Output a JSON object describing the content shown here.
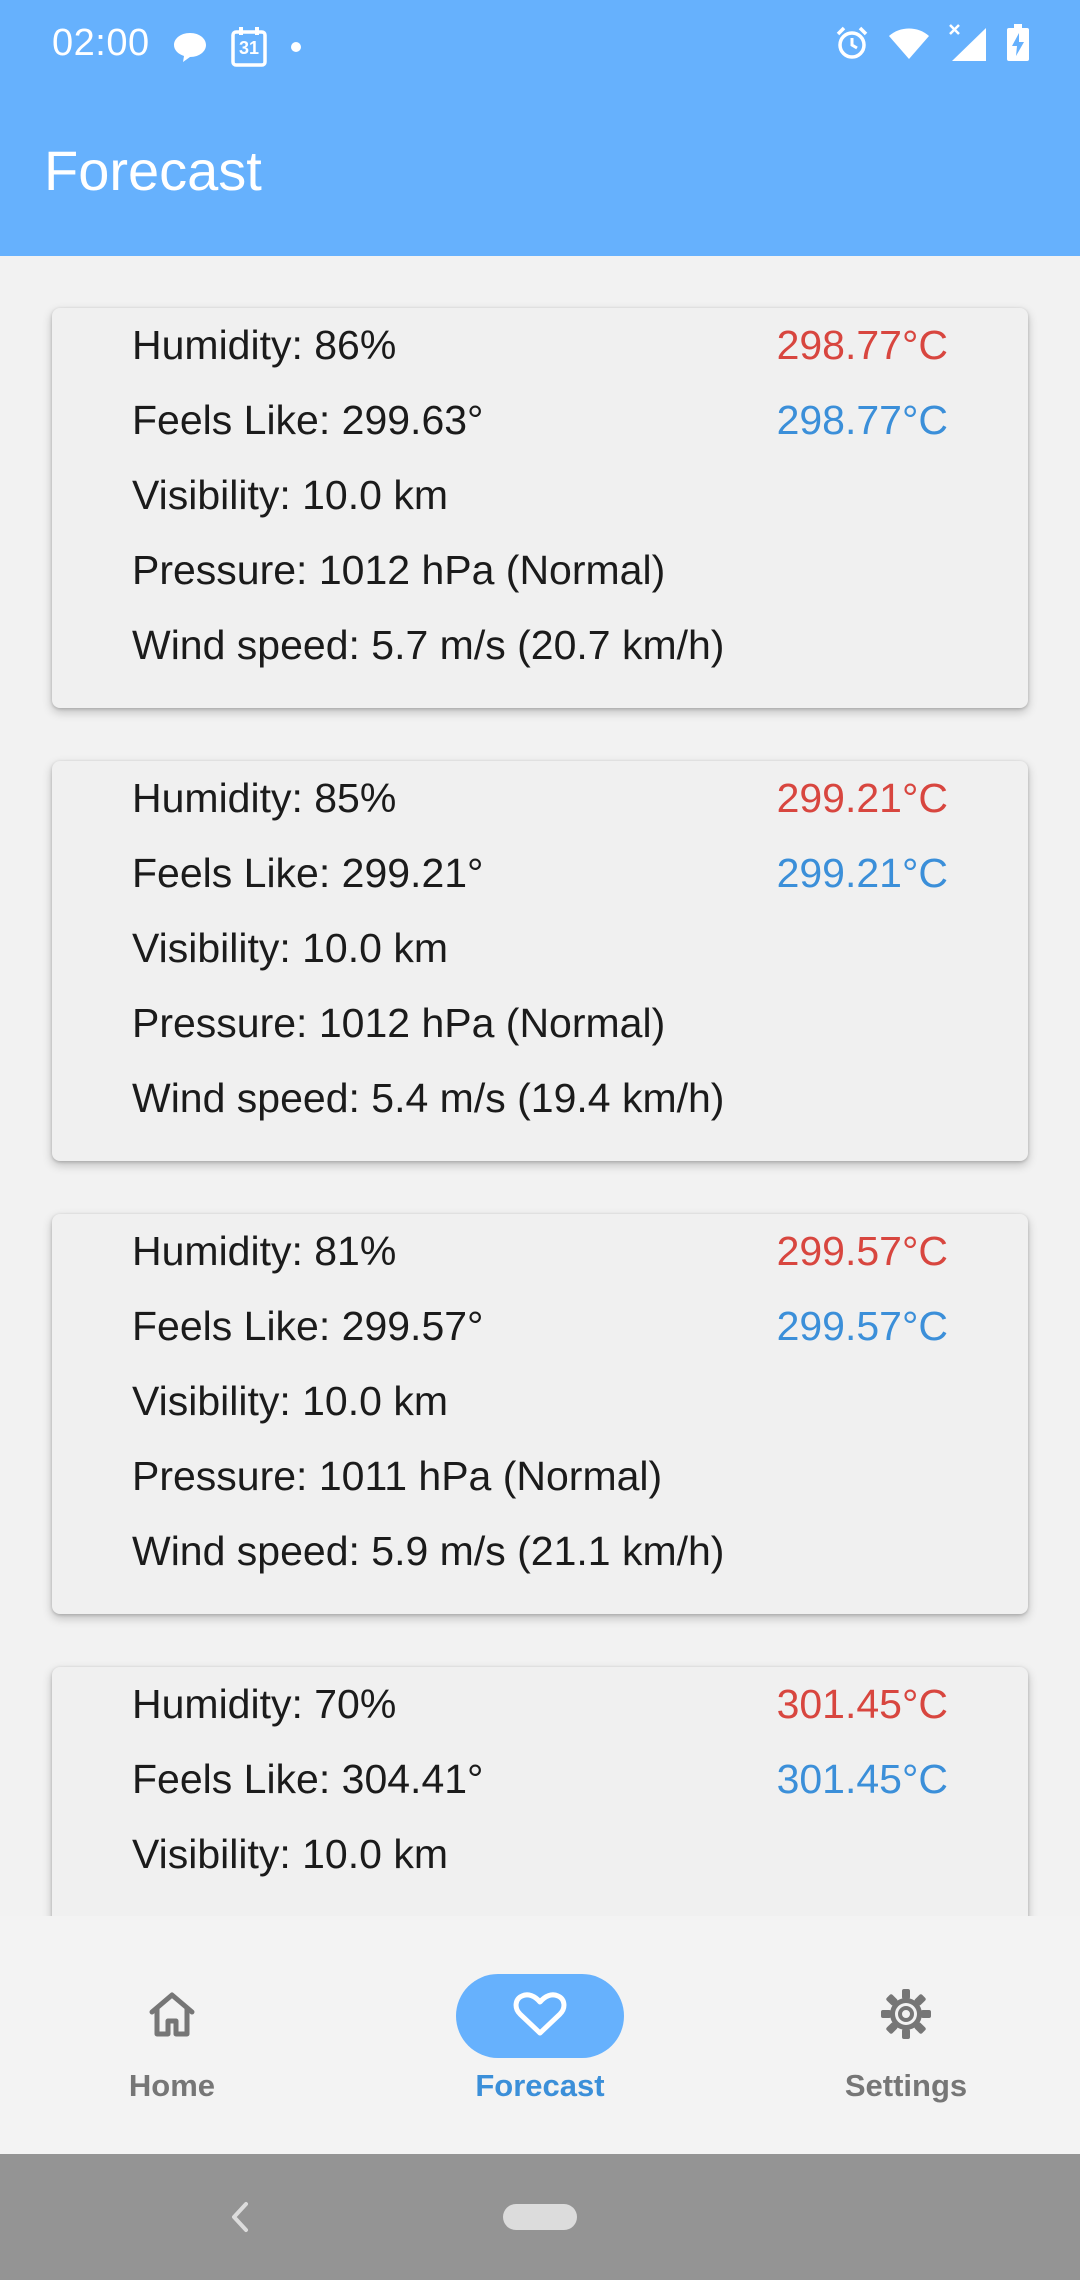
{
  "status_bar": {
    "time": "02:00",
    "left_icons": [
      "chat-bubble-icon",
      "calendar-icon",
      "notification-dot-icon"
    ],
    "calendar_day": "31",
    "right_icons": [
      "alarm-icon",
      "wifi-icon",
      "cell-signal-icon",
      "battery-charging-icon"
    ]
  },
  "app_bar": {
    "title": "Forecast"
  },
  "forecasts": [
    {
      "humidity": "Humidity: 86%",
      "temp_high": "298.77°C",
      "feels_like": "Feels Like: 299.63°",
      "temp_low": "298.77°C",
      "visibility": "Visibility: 10.0 km",
      "pressure": "Pressure: 1012 hPa (Normal)",
      "wind": "Wind speed: 5.7 m/s (20.7 km/h)"
    },
    {
      "humidity": "Humidity: 85%",
      "temp_high": "299.21°C",
      "feels_like": "Feels Like: 299.21°",
      "temp_low": "299.21°C",
      "visibility": "Visibility: 10.0 km",
      "pressure": "Pressure: 1012 hPa (Normal)",
      "wind": "Wind speed: 5.4 m/s (19.4 km/h)"
    },
    {
      "humidity": "Humidity: 81%",
      "temp_high": "299.57°C",
      "feels_like": "Feels Like: 299.57°",
      "temp_low": "299.57°C",
      "visibility": "Visibility: 10.0 km",
      "pressure": "Pressure: 1011 hPa (Normal)",
      "wind": "Wind speed: 5.9 m/s (21.1 km/h)"
    },
    {
      "humidity": "Humidity: 70%",
      "temp_high": "301.45°C",
      "feels_like": "Feels Like: 304.41°",
      "temp_low": "301.45°C",
      "visibility": "Visibility: 10.0 km"
    }
  ],
  "bottom_nav": {
    "items": [
      {
        "label": "Home",
        "icon": "home-icon",
        "active": false
      },
      {
        "label": "Forecast",
        "icon": "heart-icon",
        "active": true
      },
      {
        "label": "Settings",
        "icon": "gear-icon",
        "active": false
      }
    ]
  },
  "system_nav": {
    "icons": [
      "back-chevron-icon",
      "home-pill-icon"
    ]
  },
  "colors": {
    "primary": "#66b1fd",
    "temp_high": "#d8463f",
    "temp_low": "#3b8fd9",
    "card_background": "#f0f0f0",
    "nav_inactive": "#767676"
  }
}
